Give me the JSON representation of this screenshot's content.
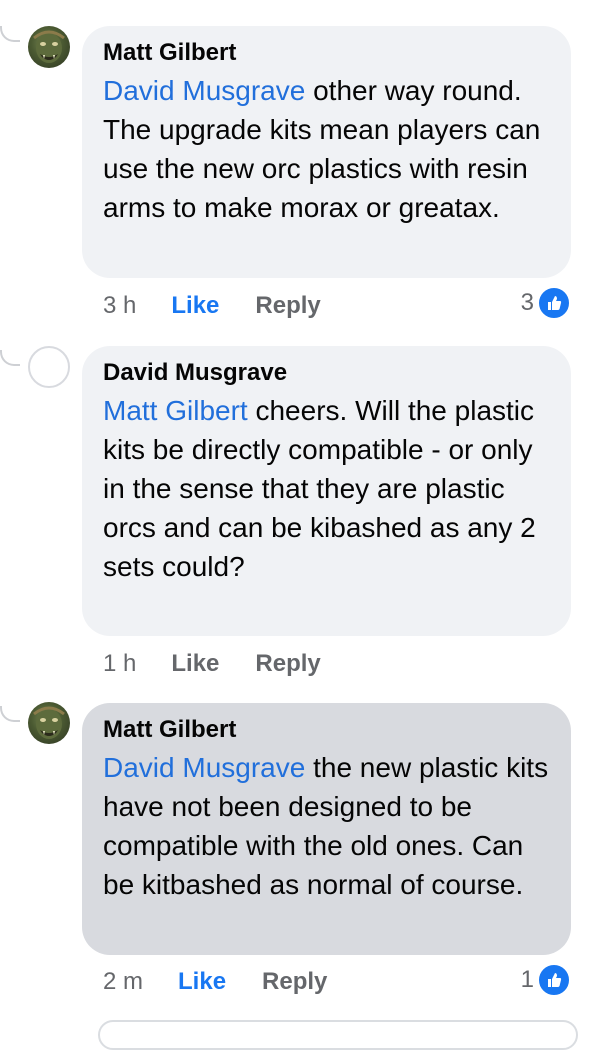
{
  "comments": [
    {
      "author": "Matt Gilbert",
      "mention": "David Musgrave",
      "text": " other way round. The upgrade kits mean players can use the new orc plastics with resin arms to make morax or greatax.",
      "time": "3 h",
      "like_label": "Like",
      "reply_label": "Reply",
      "reaction_count": "3",
      "liked": true
    },
    {
      "author": "David Musgrave",
      "mention": "Matt Gilbert",
      "text": " cheers.  Will the plastic kits be directly compatible  - or only in the sense that they are plastic orcs and can be kibashed as any 2 sets could?",
      "time": "1 h",
      "like_label": "Like",
      "reply_label": "Reply"
    },
    {
      "author": "Matt Gilbert",
      "mention": "David Musgrave",
      "text": " the new plastic kits have not been designed to be compatible with the old ones. Can be kitbashed as normal of course.",
      "time": "2 m",
      "like_label": "Like",
      "reply_label": "Reply",
      "reaction_count": "1",
      "liked": true
    }
  ],
  "colors": {
    "mention": "#216fdb",
    "like_active": "#1877f2",
    "bubble": "#f0f2f5",
    "bubble_highlighted": "#d8dadf"
  },
  "icons": {
    "reaction": "thumbs-up-icon"
  }
}
